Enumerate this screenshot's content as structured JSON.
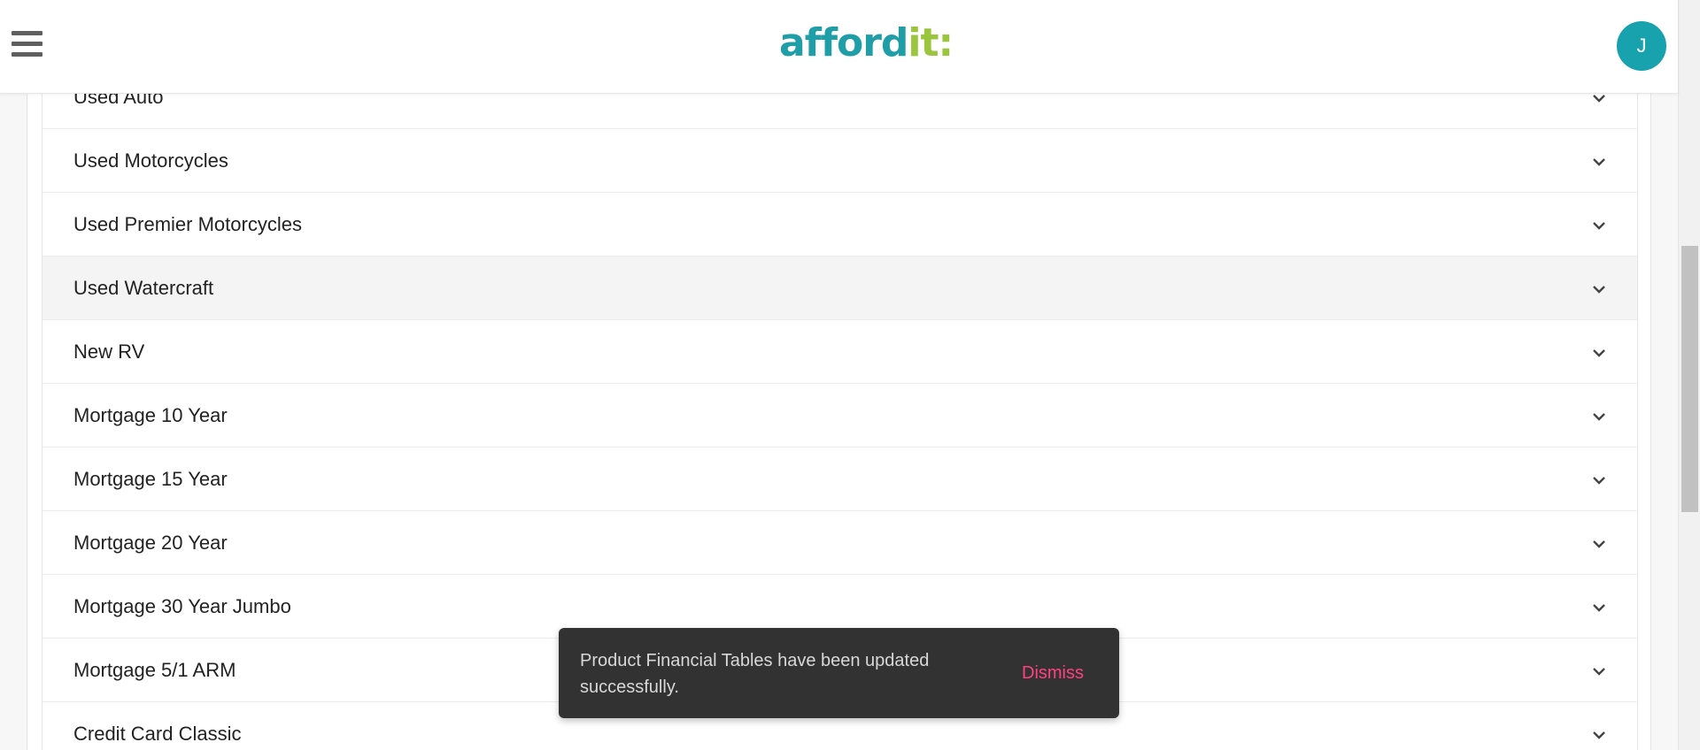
{
  "header": {
    "logo_main": "afford",
    "logo_accent": "it:",
    "avatar_initial": "J"
  },
  "products": [
    {
      "label": "Used Auto"
    },
    {
      "label": "Used Motorcycles"
    },
    {
      "label": "Used Premier Motorcycles"
    },
    {
      "label": "Used Watercraft"
    },
    {
      "label": "New RV"
    },
    {
      "label": "Mortgage 10 Year"
    },
    {
      "label": "Mortgage 15 Year"
    },
    {
      "label": "Mortgage 20 Year"
    },
    {
      "label": "Mortgage 30 Year Jumbo"
    },
    {
      "label": "Mortgage 5/1 ARM"
    },
    {
      "label": "Credit Card Classic"
    }
  ],
  "highlighted_index": 3,
  "snackbar": {
    "message": "Product Financial Tables have been updated successfully.",
    "action_label": "Dismiss"
  },
  "colors": {
    "brand_teal": "#1f9ea8",
    "brand_green": "#9bc53d",
    "avatar": "#17a2ae",
    "dismiss": "#ff4081"
  },
  "icons": [
    "menu-icon",
    "chevron-down-icon"
  ]
}
